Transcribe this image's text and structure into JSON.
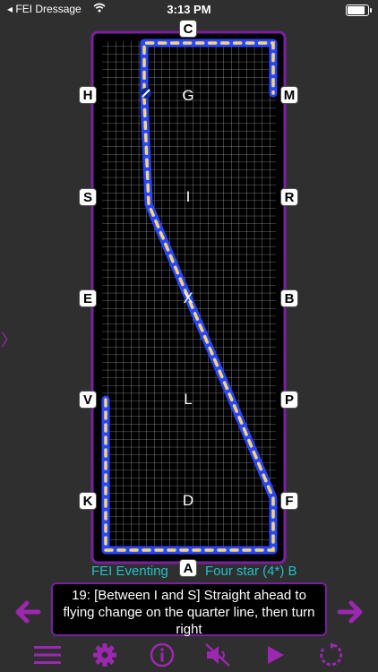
{
  "status_bar": {
    "back_app": "FEI Dressage",
    "time": "3:13 PM"
  },
  "arena": {
    "markers": {
      "C": "C",
      "H": "H",
      "M": "M",
      "S": "S",
      "R": "R",
      "E": "E",
      "B": "B",
      "V": "V",
      "P": "P",
      "K": "K",
      "F": "F",
      "A": "A"
    },
    "inner_letters": {
      "G": "G",
      "I": "I",
      "X": "X",
      "L": "L",
      "D": "D"
    },
    "colors": {
      "route": "#2946ff",
      "dashes": "#f5d76e",
      "border": "#7b1fa2",
      "grid": "#ffffff"
    }
  },
  "test": {
    "category": "FEI Eventing",
    "level": "Four star (4*) B"
  },
  "instruction": {
    "text": "19: [Between I and S] Straight ahead to flying change on the quarter line, then turn right"
  },
  "navigation": {
    "prev_icon": "arrow-left-icon",
    "next_icon": "arrow-right-icon"
  },
  "toolbar": {
    "items": [
      "menu-icon",
      "gear-icon",
      "info-icon",
      "mute-icon",
      "play-icon",
      "replay-icon"
    ],
    "accent": "#9c27b0"
  }
}
